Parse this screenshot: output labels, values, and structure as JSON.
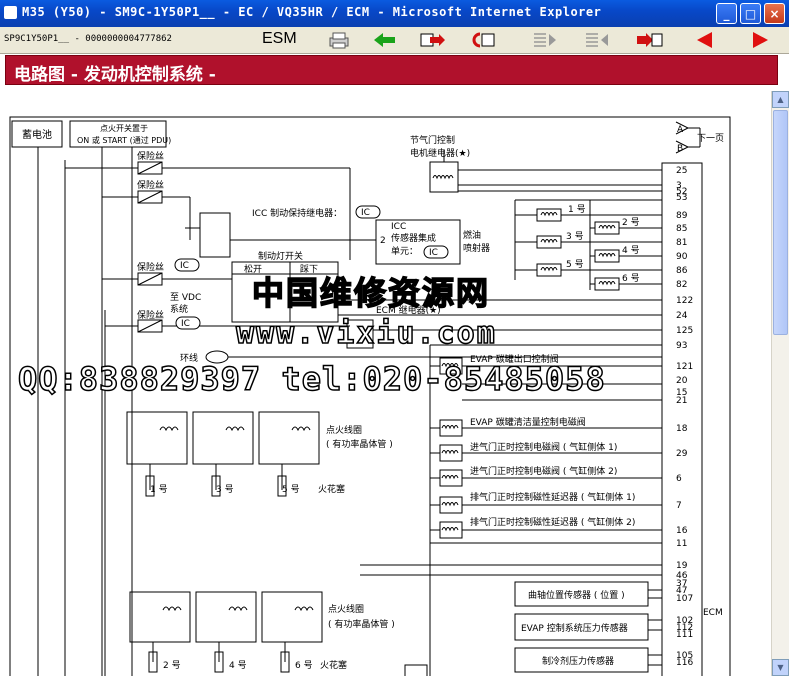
{
  "window": {
    "title": "M35 (Y50) - SM9C-1Y50P1__ - EC / VQ35HR / ECM - Microsoft Internet Explorer",
    "min": "_",
    "max": "□",
    "close": "×"
  },
  "toolbar": {
    "doc_id": "SP9C1Y50P1__ - 0000000004777862",
    "esm_label": "ESM"
  },
  "banner": {
    "title": "电路图 - 发动机控制系统 -"
  },
  "watermarks": {
    "line1": "中国维修资源网",
    "line2": "www.vixiu.com",
    "line3": "QQ:838829397  tel:020-85485058"
  },
  "diagram": {
    "battery": "蓄电池",
    "ign_switch_1": "点火开关置于",
    "ign_switch_2": "ON 或 START (通过 PDU)",
    "fuse": "保险丝",
    "throttle_relay_1": "节气门控制",
    "throttle_relay_2": "电机继电器(★)",
    "icc_relay": "ICC 制动保持继电器：",
    "ic": "IC",
    "icc_sensor_1": "ICC",
    "icc_sensor_2": "传感器集成",
    "icc_sensor_3": "单元：",
    "icc_num": "2",
    "injector_1": "燃油",
    "injector_2": "喷射器",
    "inj1": "1 号",
    "inj2": "2 号",
    "inj3": "3 号",
    "inj4": "4 号",
    "inj5": "5 号",
    "inj6": "6 号",
    "brake_switch": "制动灯开关",
    "release": "松开",
    "press": "踩下",
    "vdc_1": "至 VDC",
    "vdc_2": "系统",
    "ecm_relay": "ECM 继电器(★)",
    "loop": "环线",
    "evap_outlet": "EVAP 碳罐出口控制阀",
    "evap_purge": "EVAP 碳罐清洁量控制电磁阀",
    "intake_valve_1": "进气门正时控制电磁阀 ( 气缸侧体 1)",
    "intake_valve_2": "进气门正时控制电磁阀 ( 气缸侧体 2)",
    "exhaust_valve_1": "排气门正时控制磁性延迟器 ( 气缸侧体 1)",
    "exhaust_valve_2": "排气门正时控制磁性延迟器 ( 气缸侧体 2)",
    "ign_coil_1": "点火线圈",
    "ign_coil_2": "( 有功率晶体管 )",
    "spark_plug": "火花塞",
    "cyl1": "1 号",
    "cyl3": "3 号",
    "cyl5": "5 号",
    "cyl2": "2 号",
    "cyl4": "4 号",
    "cyl6": "6 号",
    "crank_sensor": "曲轴位置传感器 ( 位置 )",
    "evap_pressure": "EVAP 控制系统压力传感器",
    "refrigerant": "制冷剂压力传感器",
    "ecm": "ECM",
    "next_page": "下一页",
    "conn_a": "A",
    "conn_b": "B",
    "pins": [
      "25",
      "3",
      "52",
      "53",
      "89",
      "85",
      "81",
      "90",
      "86",
      "82",
      "122",
      "24",
      "125",
      "93",
      "121",
      "20",
      "15",
      "21",
      "18",
      "29",
      "6",
      "7",
      "16",
      "11",
      "19",
      "46",
      "37",
      "47",
      "107",
      "102",
      "112",
      "111",
      "105",
      "116"
    ]
  }
}
